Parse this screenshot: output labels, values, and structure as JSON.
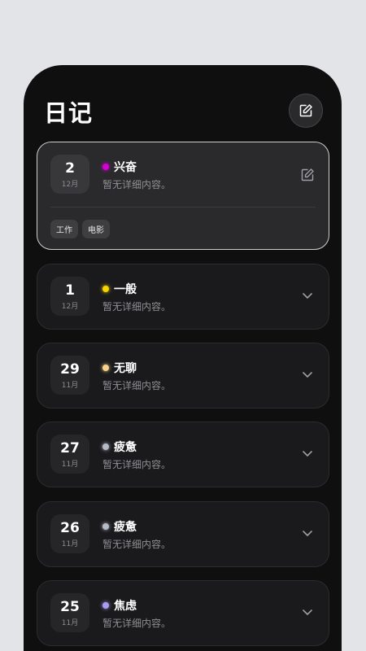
{
  "header": {
    "title": "日记"
  },
  "entries": [
    {
      "day": "2",
      "month": "12月",
      "mood": "兴奋",
      "mood_color": "#d400d4",
      "preview": "暂无详细内容。",
      "expanded": true,
      "tags": [
        "工作",
        "电影"
      ]
    },
    {
      "day": "1",
      "month": "12月",
      "mood": "一般",
      "mood_color": "#f5d400",
      "preview": "暂无详细内容。",
      "expanded": false
    },
    {
      "day": "29",
      "month": "11月",
      "mood": "无聊",
      "mood_color": "#f6d28a",
      "preview": "暂无详细内容。",
      "expanded": false
    },
    {
      "day": "27",
      "month": "11月",
      "mood": "疲惫",
      "mood_color": "#b5bcc8",
      "preview": "暂无详细内容。",
      "expanded": false
    },
    {
      "day": "26",
      "month": "11月",
      "mood": "疲惫",
      "mood_color": "#b5bcc8",
      "preview": "暂无详细内容。",
      "expanded": false
    },
    {
      "day": "25",
      "month": "11月",
      "mood": "焦虑",
      "mood_color": "#a89cf0",
      "preview": "暂无详细内容。",
      "expanded": false
    }
  ],
  "icons": {
    "new_entry": "edit-square-icon",
    "edit": "edit-square-icon",
    "expand": "chevron-down-icon"
  }
}
